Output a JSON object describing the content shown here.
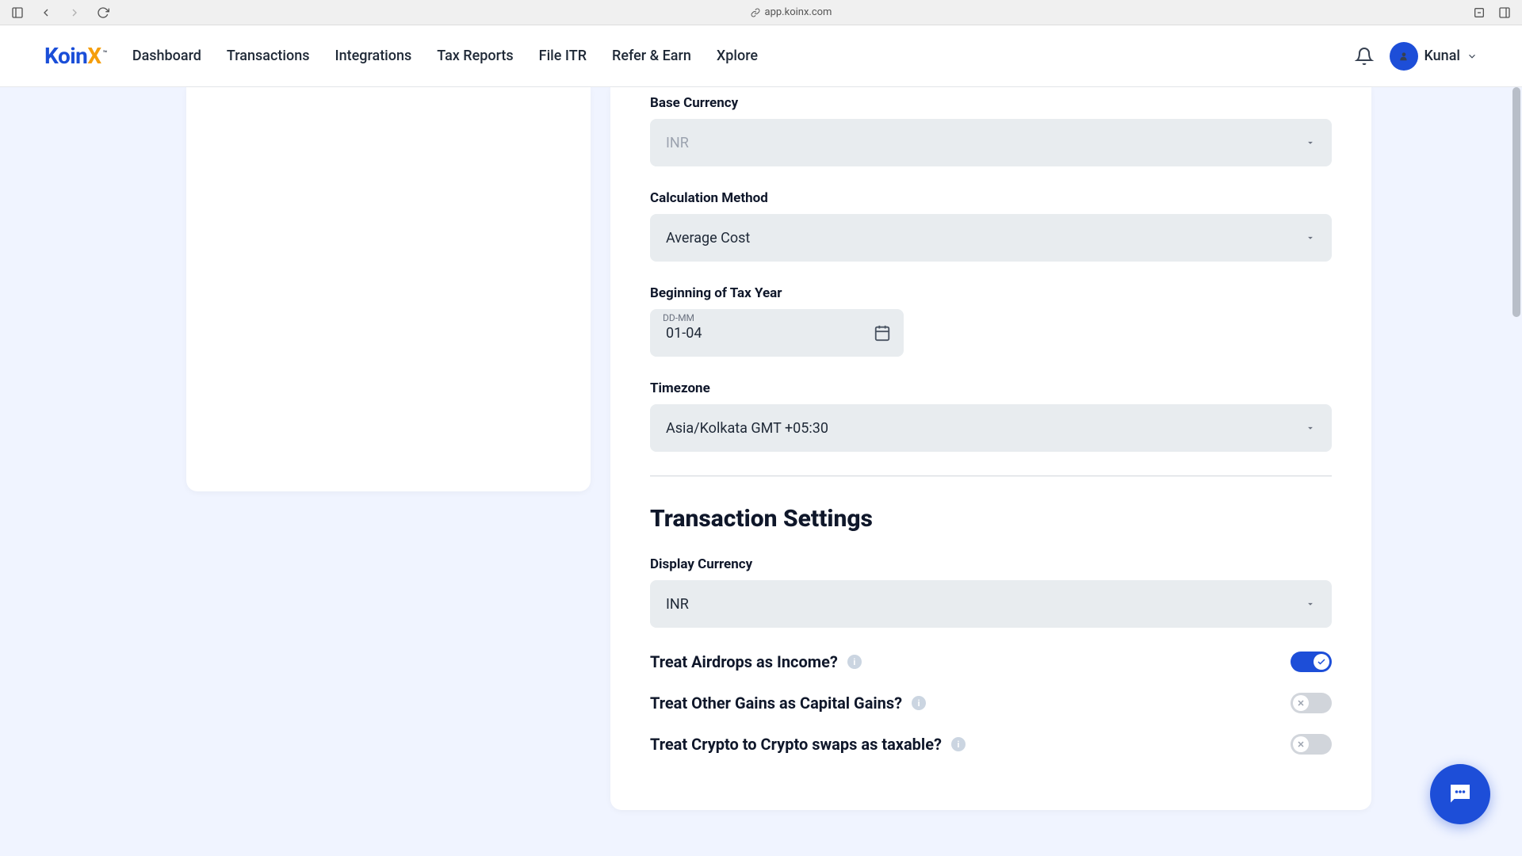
{
  "browser": {
    "url": "app.koinx.com"
  },
  "nav": {
    "links": [
      "Dashboard",
      "Transactions",
      "Integrations",
      "Tax Reports",
      "File ITR",
      "Refer & Earn",
      "Xplore"
    ],
    "user_name": "Kunal"
  },
  "settings": {
    "base_currency_label": "Base Currency",
    "base_currency_value": "INR",
    "calc_method_label": "Calculation Method",
    "calc_method_value": "Average Cost",
    "tax_year_label": "Beginning of Tax Year",
    "tax_year_placeholder": "DD-MM",
    "tax_year_value": "01-04",
    "timezone_label": "Timezone",
    "timezone_value": "Asia/Kolkata GMT +05:30",
    "transaction_section_title": "Transaction Settings",
    "display_currency_label": "Display Currency",
    "display_currency_value": "INR",
    "toggle_airdrops": "Treat Airdrops as Income?",
    "toggle_other_gains": "Treat Other Gains as Capital Gains?",
    "toggle_crypto_swaps": "Treat Crypto to Crypto swaps as taxable?"
  }
}
